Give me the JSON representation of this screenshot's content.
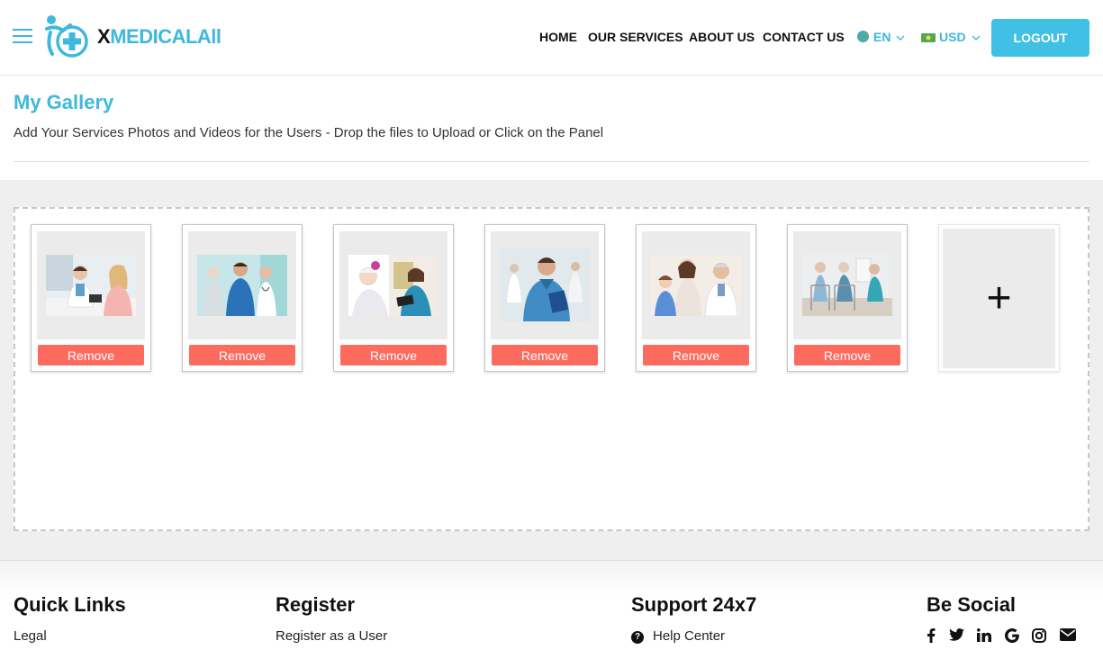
{
  "brand": {
    "name_prefix": "X",
    "name_rest": "MEDICALAll",
    "accent_color": "#3fb8de"
  },
  "nav": {
    "home": "HOME",
    "services": "OUR SERVICES",
    "about": "ABOUT US",
    "contact": "CONTACT US",
    "language": "EN",
    "currency": "USD",
    "logout": "LOGOUT"
  },
  "page": {
    "title": "My Gallery",
    "subtitle": "Add Your Services Photos and Videos for the Users - Drop the files to Upload or Click on the Panel"
  },
  "gallery": {
    "remove_label": "Remove",
    "add_label": "+",
    "remove_color": "#fd6b5e",
    "items": [
      {
        "icon": "doctor-consultation-photo"
      },
      {
        "icon": "medical-team-photo"
      },
      {
        "icon": "nurse-elderly-patient-photo"
      },
      {
        "icon": "doctor-clipboard-photo"
      },
      {
        "icon": "doctor-child-patient-photo"
      },
      {
        "icon": "elderly-walkers-photo"
      }
    ]
  },
  "footer": {
    "quick_links": {
      "heading": "Quick Links",
      "items": [
        "Legal"
      ]
    },
    "register": {
      "heading": "Register",
      "items": [
        "Register as a User"
      ]
    },
    "support": {
      "heading": "Support 24x7",
      "items": [
        "Help Center"
      ]
    },
    "social": {
      "heading": "Be Social",
      "icons": [
        "facebook-icon",
        "twitter-icon",
        "linkedin-icon",
        "google-icon",
        "instagram-icon",
        "mail-icon"
      ]
    }
  }
}
